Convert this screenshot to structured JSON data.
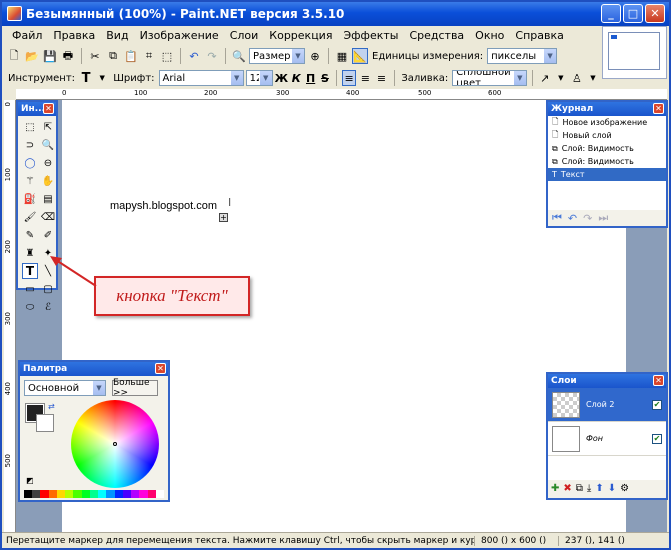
{
  "window": {
    "title": "Безымянный (100%) - Paint.NET версия 3.5.10"
  },
  "menu": [
    "Файл",
    "Правка",
    "Вид",
    "Изображение",
    "Слои",
    "Коррекция",
    "Эффекты",
    "Средства",
    "Окно",
    "Справка"
  ],
  "toolbar1": {
    "zoom_value": "Размер о",
    "units_label": "Единицы измерения:",
    "units_value": "пикселы"
  },
  "toolbar2": {
    "tool_label": "Инструмент:",
    "font_label": "Шрифт:",
    "font_value": "Arial",
    "size_value": "12",
    "bold": "Ж",
    "italic": "К",
    "underline": "П",
    "fill_label": "Заливка:",
    "fill_value": "Сплошной цвет"
  },
  "ruler": {
    "top": [
      "0",
      "100",
      "200",
      "300",
      "400",
      "500",
      "600"
    ],
    "left": [
      "0",
      "100",
      "200",
      "300",
      "400",
      "500"
    ]
  },
  "canvas": {
    "text": "mapysh.blogspot.com"
  },
  "tools_panel": {
    "title": "Ин..."
  },
  "history": {
    "title": "Журнал",
    "items": [
      "Новое изображение",
      "Новый слой",
      "Слой: Видимость",
      "Слой: Видимость",
      "Текст"
    ],
    "active_index": 4
  },
  "layers": {
    "title": "Слои",
    "items": [
      {
        "name": "Слой 2",
        "visible": true,
        "active": true
      },
      {
        "name": "Фон",
        "visible": true,
        "active": false
      }
    ]
  },
  "palette": {
    "title": "Палитра",
    "mode_value": "Основной",
    "more_button": "Больше >>"
  },
  "callout": {
    "text": "кнопка \"Текст\""
  },
  "status": {
    "hint": "Перетащите маркер для перемещения текста. Нажмите клавишу Ctrl, чтобы скрыть маркер и курсор. Нажмит",
    "size": "800 () x 600 ()",
    "position": "237 (), 141 ()"
  },
  "colors": {
    "titlebar": "#0a4fd9",
    "panel_border": "#3264c8",
    "callout_red": "#d32626",
    "selection": "#316ac5"
  }
}
